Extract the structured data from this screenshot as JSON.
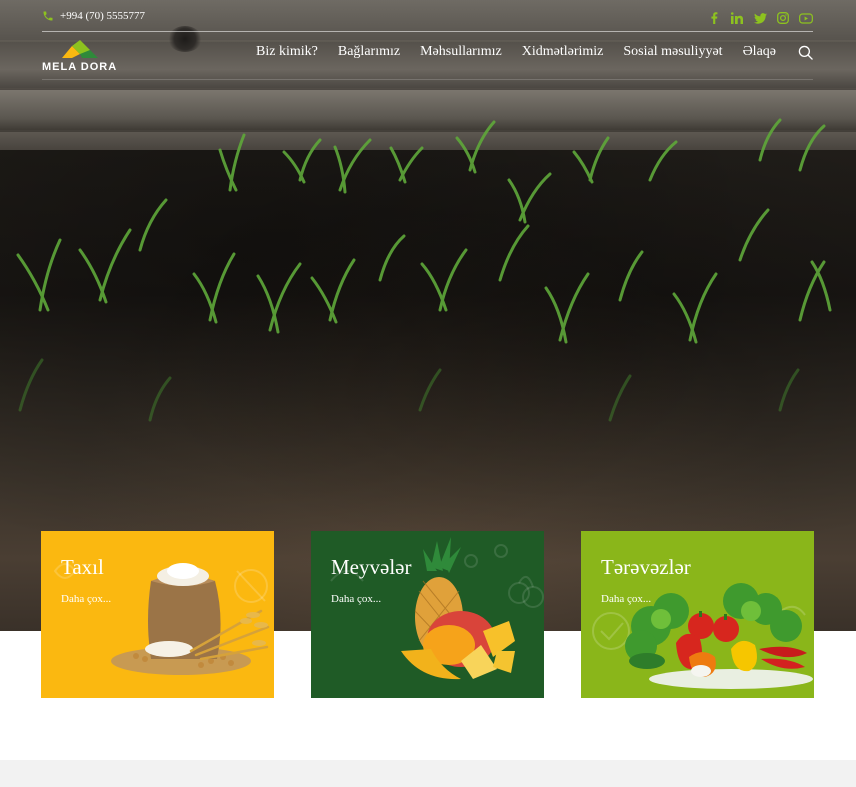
{
  "topbar": {
    "phone": "+994 (70) 5555777",
    "socials": [
      "facebook-icon",
      "linkedin-icon",
      "twitter-icon",
      "instagram-icon",
      "youtube-icon"
    ]
  },
  "brand": {
    "name": "MELA DORA",
    "accent": "#8dc21f",
    "mark_yellow": "#fbb810"
  },
  "nav": {
    "items": [
      "Biz kimik?",
      "Bağlarımız",
      "Məhsullarımız",
      "Xidmətlərimiz",
      "Sosial məsuliyyət",
      "Əlaqə"
    ],
    "search_icon": "search-icon"
  },
  "hero": {
    "image": "seedlings-in-soil-photo"
  },
  "cards": [
    {
      "title": "Taxıl",
      "link": "Daha çox...",
      "color": "#fbb810"
    },
    {
      "title": "Meyvələr",
      "link": "Daha çox...",
      "color": "#1f5b26"
    },
    {
      "title": "Tərəvəzlər",
      "link": "Daha çox...",
      "color": "#8ab61a"
    }
  ]
}
